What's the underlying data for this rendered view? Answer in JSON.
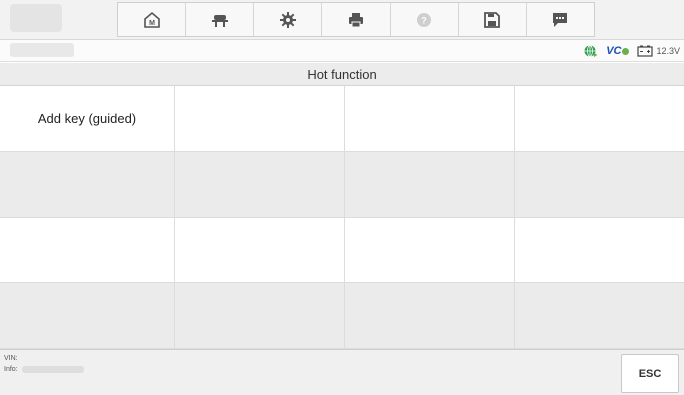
{
  "toolbar": {
    "buttons": [
      {
        "name": "home",
        "icon": "home-icon"
      },
      {
        "name": "vehicle",
        "icon": "car-lift-icon"
      },
      {
        "name": "settings",
        "icon": "gear-icon"
      },
      {
        "name": "print",
        "icon": "printer-icon"
      },
      {
        "name": "help",
        "icon": "help-icon"
      },
      {
        "name": "save",
        "icon": "save-icon"
      },
      {
        "name": "message",
        "icon": "message-icon"
      }
    ],
    "icon_color": "#555555"
  },
  "status": {
    "vc_label": "VC",
    "voltage": "12.3V",
    "globe_color": "#2b9c4a",
    "vc_color": "#1f4fb8"
  },
  "title": "Hot function",
  "grid": {
    "rows": [
      [
        "Add key (guided)",
        "",
        "",
        ""
      ],
      [
        "",
        "",
        "",
        ""
      ],
      [
        "",
        "",
        "",
        ""
      ],
      [
        "",
        "",
        "",
        ""
      ]
    ]
  },
  "footer": {
    "vin_label": "VIN:",
    "info_label": "Info:",
    "esc_label": "ESC"
  }
}
